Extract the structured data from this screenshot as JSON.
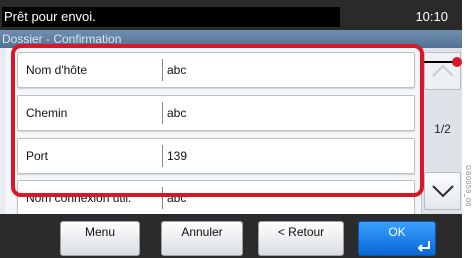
{
  "status": {
    "message": "Prêt pour envoi.",
    "time": "10:10"
  },
  "title": "Dossier - Confirmation",
  "rows": [
    {
      "label": "Nom d'hôte",
      "value": "abc"
    },
    {
      "label": "Chemin",
      "value": "abc"
    },
    {
      "label": "Port",
      "value": "139"
    },
    {
      "label": "Nom connexion util.",
      "value": "abc"
    }
  ],
  "pagination": {
    "indicator": "1/2",
    "up_icon": "chevron-up-icon",
    "down_icon": "chevron-down-icon"
  },
  "buttons": {
    "menu": "Menu",
    "cancel": "Annuler",
    "back": "< Retour",
    "ok": "OK",
    "ok_icon": "enter-icon"
  },
  "side_code": "GB0059_00",
  "colors": {
    "highlight": "#d8172b",
    "primary": "#0a67d6",
    "status_bar": "#2a2a2a"
  }
}
